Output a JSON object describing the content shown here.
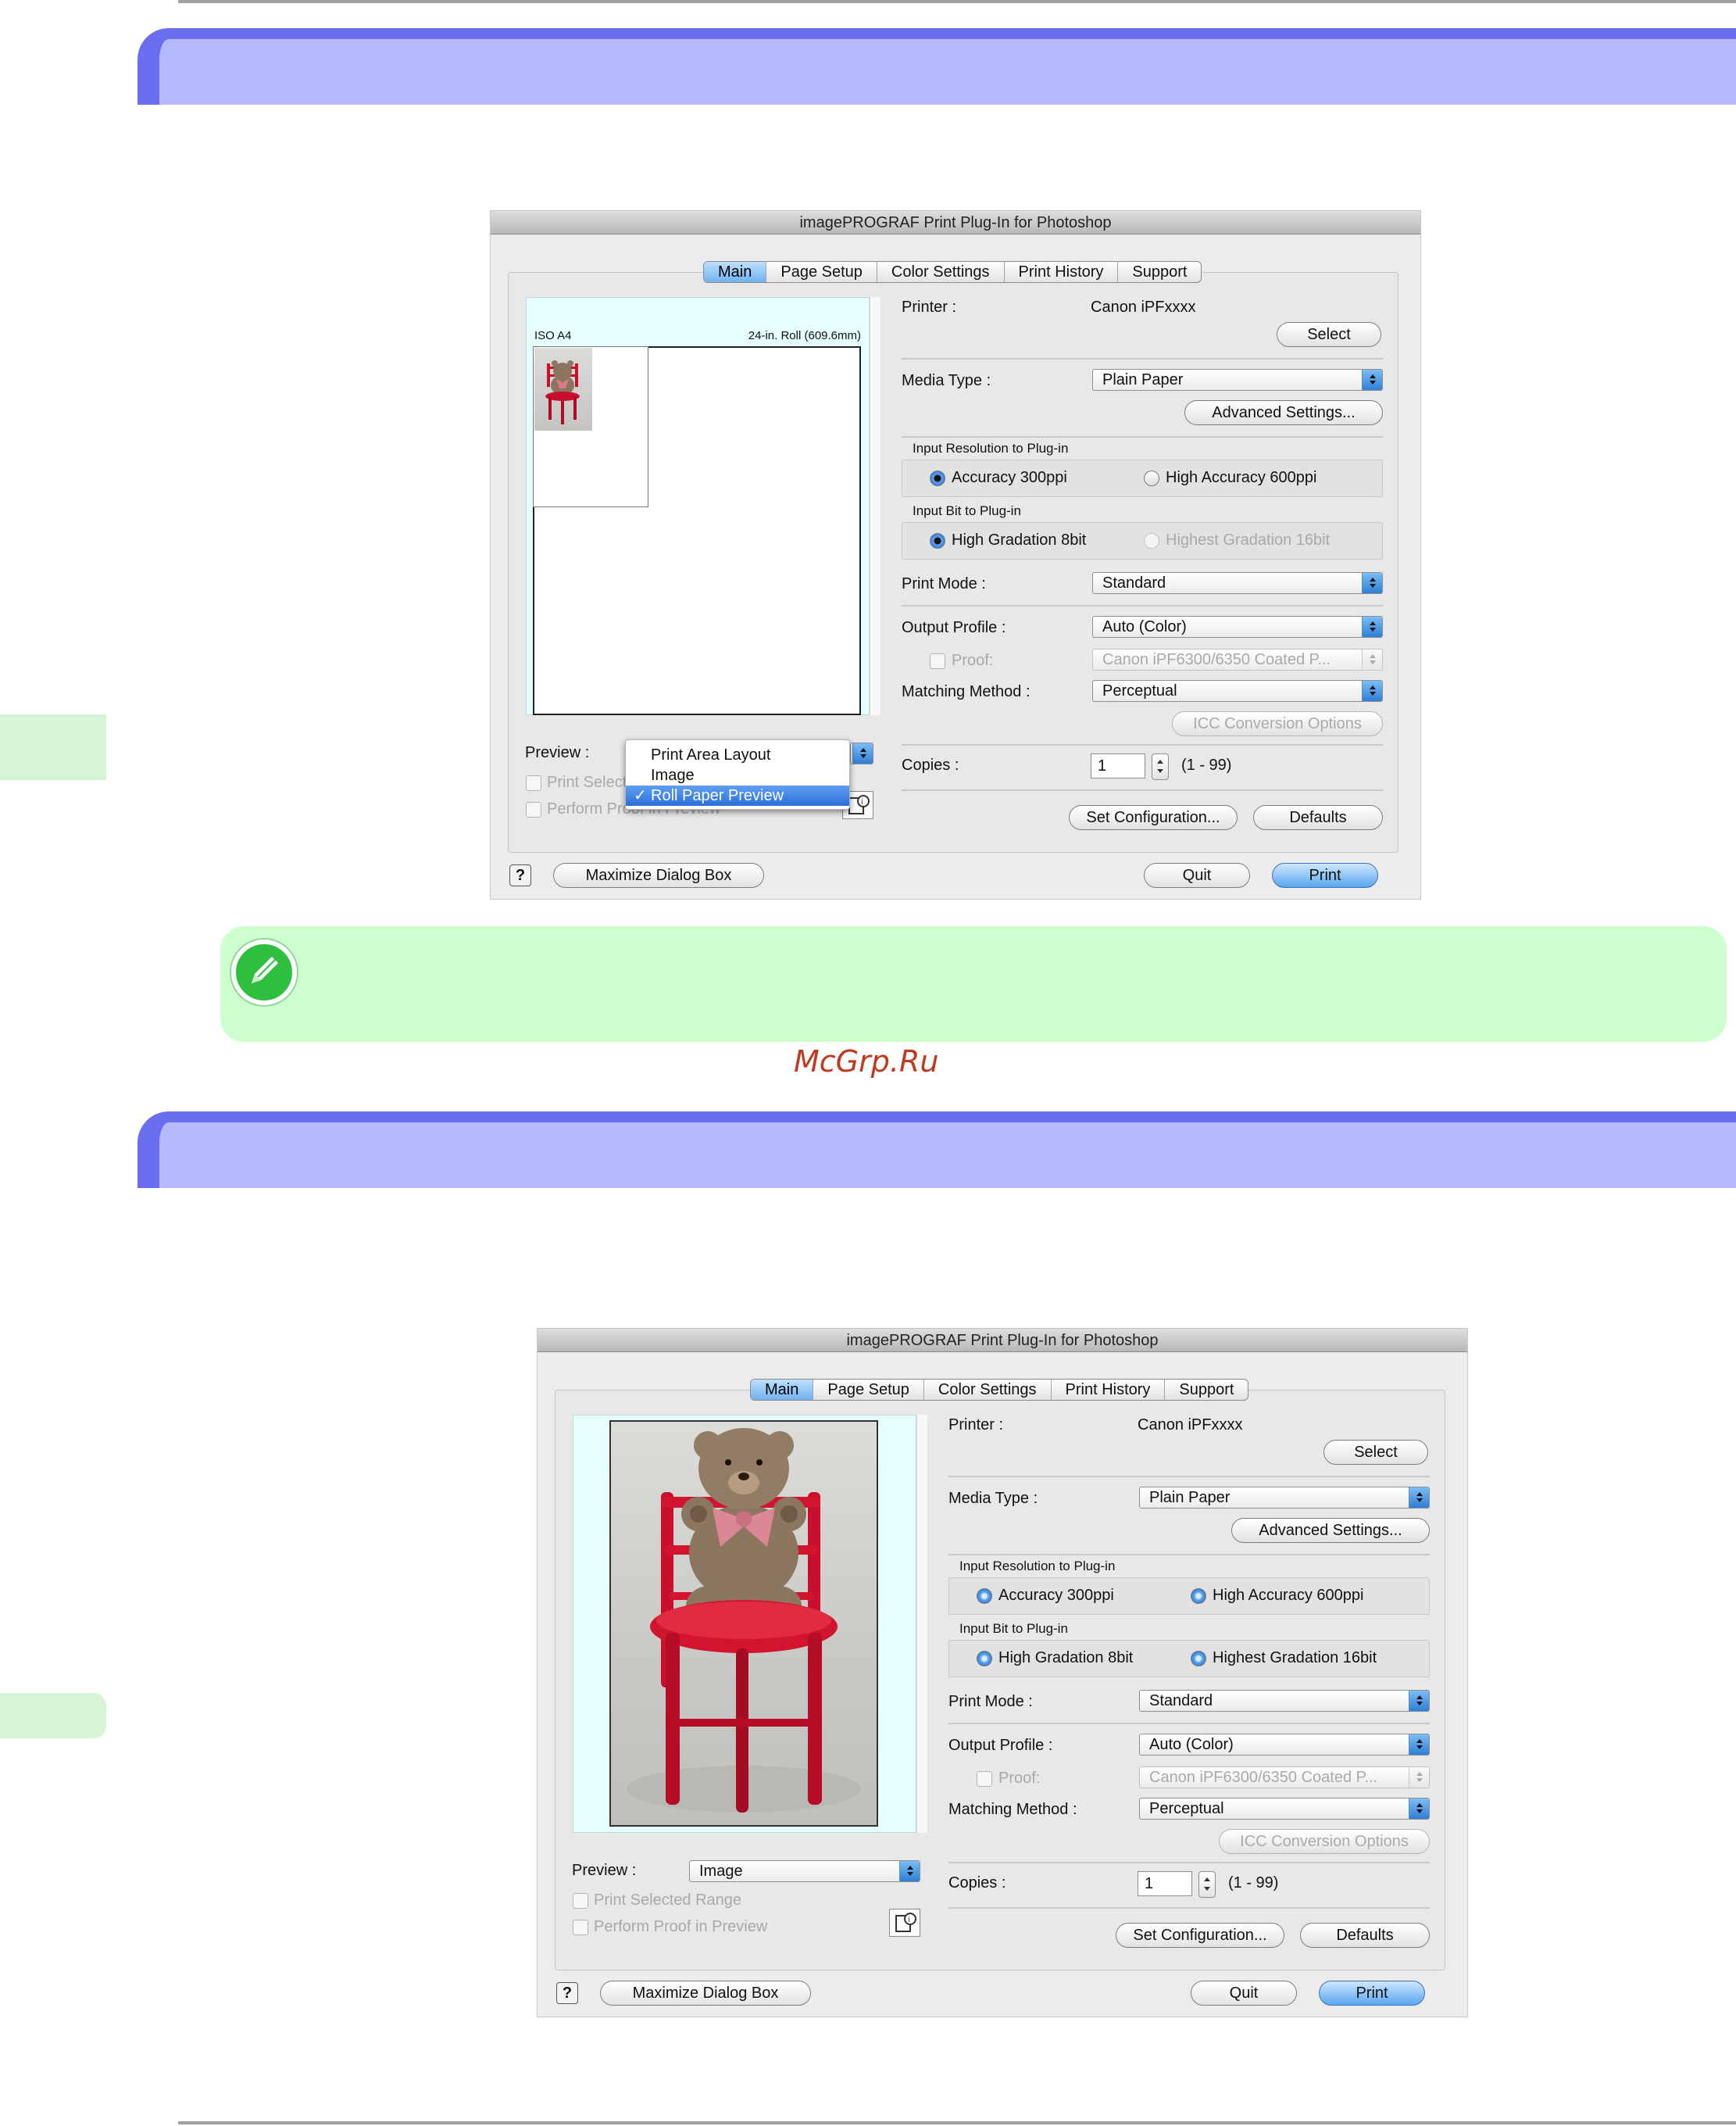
{
  "watermark": "McGrp.Ru",
  "dialog1": {
    "title": "imagePROGRAF Print Plug-In for Photoshop",
    "tabs": [
      "Main",
      "Page Setup",
      "Color Settings",
      "Print History",
      "Support"
    ],
    "preview_header_left": "ISO A4",
    "preview_header_right": "24-in. Roll (609.6mm)",
    "printer_label": "Printer :",
    "printer_value": "Canon iPFxxxx",
    "select_btn": "Select",
    "media_type_label": "Media Type :",
    "media_type_value": "Plain Paper",
    "advanced_btn": "Advanced Settings...",
    "input_res_group": "Input Resolution to Plug-in",
    "res_opt1": "Accuracy 300ppi",
    "res_opt2": "High Accuracy 600ppi",
    "input_bit_group": "Input Bit to Plug-in",
    "bit_opt1": "High Gradation 8bit",
    "bit_opt2": "Highest Gradation 16bit",
    "print_mode_label": "Print Mode :",
    "print_mode_value": "Standard",
    "output_profile_label": "Output Profile :",
    "output_profile_value": "Auto (Color)",
    "proof_label": "Proof:",
    "proof_value": "Canon iPF6300/6350 Coated P...",
    "matching_label": "Matching Method :",
    "matching_value": "Perceptual",
    "icc_btn": "ICC Conversion Options",
    "copies_label": "Copies :",
    "copies_value": "1",
    "copies_range": "(1 - 99)",
    "setconf_btn": "Set Configuration...",
    "defaults_btn": "Defaults",
    "preview_label": "Preview :",
    "print_selected_trunc": "Print Select",
    "perform_proof_trunc": "Perform Proof in Preview",
    "menu_items": [
      "Print Area Layout",
      "Image",
      "Roll Paper Preview"
    ],
    "menu_check": "✓",
    "help": "?",
    "maximize_btn": "Maximize Dialog Box",
    "quit_btn": "Quit",
    "print_btn": "Print"
  },
  "dialog2": {
    "title": "imagePROGRAF Print Plug-In for Photoshop",
    "tabs": [
      "Main",
      "Page Setup",
      "Color Settings",
      "Print History",
      "Support"
    ],
    "printer_label": "Printer :",
    "printer_value": "Canon iPFxxxx",
    "select_btn": "Select",
    "media_type_label": "Media Type :",
    "media_type_value": "Plain Paper",
    "advanced_btn": "Advanced Settings...",
    "input_res_group": "Input Resolution to Plug-in",
    "res_opt1": "Accuracy 300ppi",
    "res_opt2": "High Accuracy 600ppi",
    "input_bit_group": "Input Bit to Plug-in",
    "bit_opt1": "High Gradation 8bit",
    "bit_opt2": "Highest Gradation 16bit",
    "print_mode_label": "Print Mode :",
    "print_mode_value": "Standard",
    "output_profile_label": "Output Profile :",
    "output_profile_value": "Auto (Color)",
    "proof_label": "Proof:",
    "proof_value": "Canon iPF6300/6350 Coated P...",
    "matching_label": "Matching Method :",
    "matching_value": "Perceptual",
    "icc_btn": "ICC Conversion Options",
    "copies_label": "Copies :",
    "copies_value": "1",
    "copies_range": "(1 - 99)",
    "setconf_btn": "Set Configuration...",
    "defaults_btn": "Defaults",
    "preview_label": "Preview :",
    "preview_value": "Image",
    "print_selected": "Print Selected Range",
    "perform_proof": "Perform Proof in Preview",
    "help": "?",
    "maximize_btn": "Maximize Dialog Box",
    "quit_btn": "Quit",
    "print_btn": "Print"
  },
  "colors": {
    "band": "#b7b9ff",
    "band_edge": "#6a6ef0",
    "note_bg": "#ceffce",
    "side_tab": "#d5f5d5",
    "watermark": "#c0391f",
    "accent": "#2f7fd6"
  }
}
